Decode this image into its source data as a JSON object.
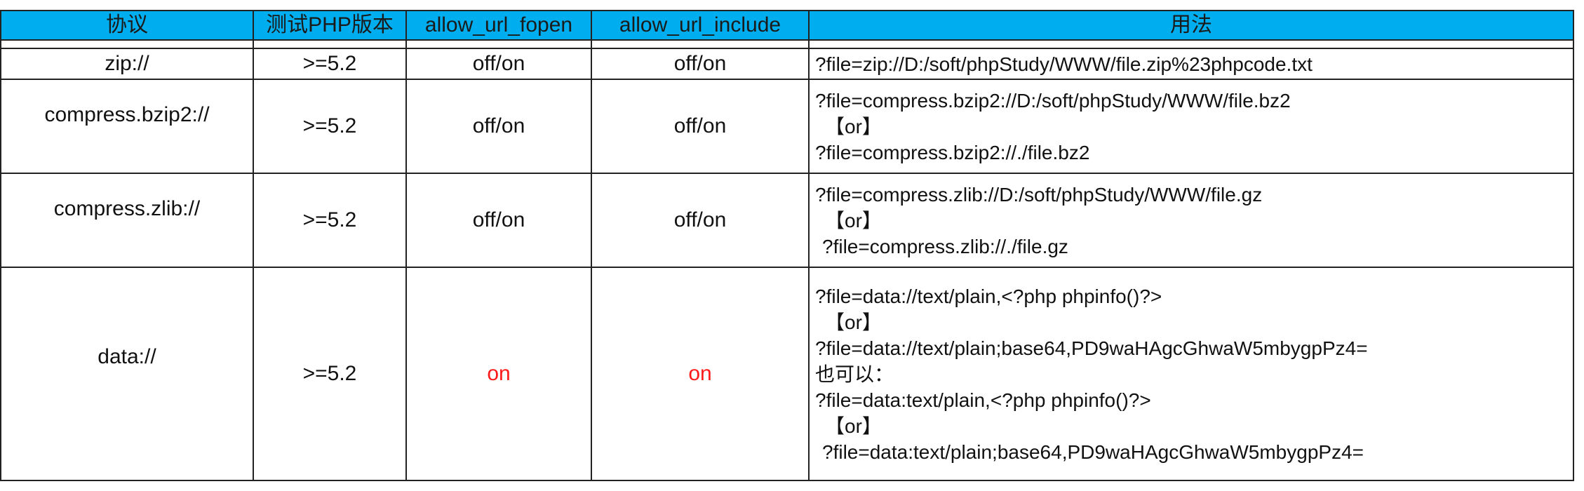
{
  "header": {
    "protocol": "协议",
    "php_version": "测试PHP版本",
    "allow_url_fopen": "allow_url_fopen",
    "allow_url_include": "allow_url_include",
    "usage": "用法"
  },
  "rows": [
    {
      "protocol": "zip://",
      "php_version": ">=5.2",
      "allow_url_fopen": "off/on",
      "allow_url_include": "off/on",
      "usage": [
        "?file=zip://D:/soft/phpStudy/WWW/file.zip%23phpcode.txt"
      ]
    },
    {
      "protocol": "compress.bzip2://",
      "php_version": ">=5.2",
      "allow_url_fopen": "off/on",
      "allow_url_include": "off/on",
      "usage": [
        "?file=compress.bzip2://D:/soft/phpStudy/WWW/file.bz2",
        "【or】",
        "?file=compress.bzip2://./file.bz2"
      ]
    },
    {
      "protocol": "compress.zlib://",
      "php_version": ">=5.2",
      "allow_url_fopen": "off/on",
      "allow_url_include": "off/on",
      "usage": [
        "?file=compress.zlib://D:/soft/phpStudy/WWW/file.gz",
        "【or】",
        "?file=compress.zlib://./file.gz"
      ]
    },
    {
      "protocol": "data://",
      "php_version": ">=5.2",
      "allow_url_fopen": "on",
      "allow_url_include": "on",
      "usage": [
        "?file=data://text/plain,<?php phpinfo()?>",
        "【or】",
        "?file=data://text/plain;base64,PD9waHAgcGhwaW5mbygpPz4=",
        "也可以：",
        "?file=data:text/plain,<?php phpinfo()?>",
        "【or】",
        "?file=data:text/plain;base64,PD9waHAgcGhwaW5mbygpPz4="
      ]
    }
  ],
  "colors": {
    "header_bg": "#00aeef",
    "on_value": "#ff1a1a",
    "border": "#222222"
  }
}
